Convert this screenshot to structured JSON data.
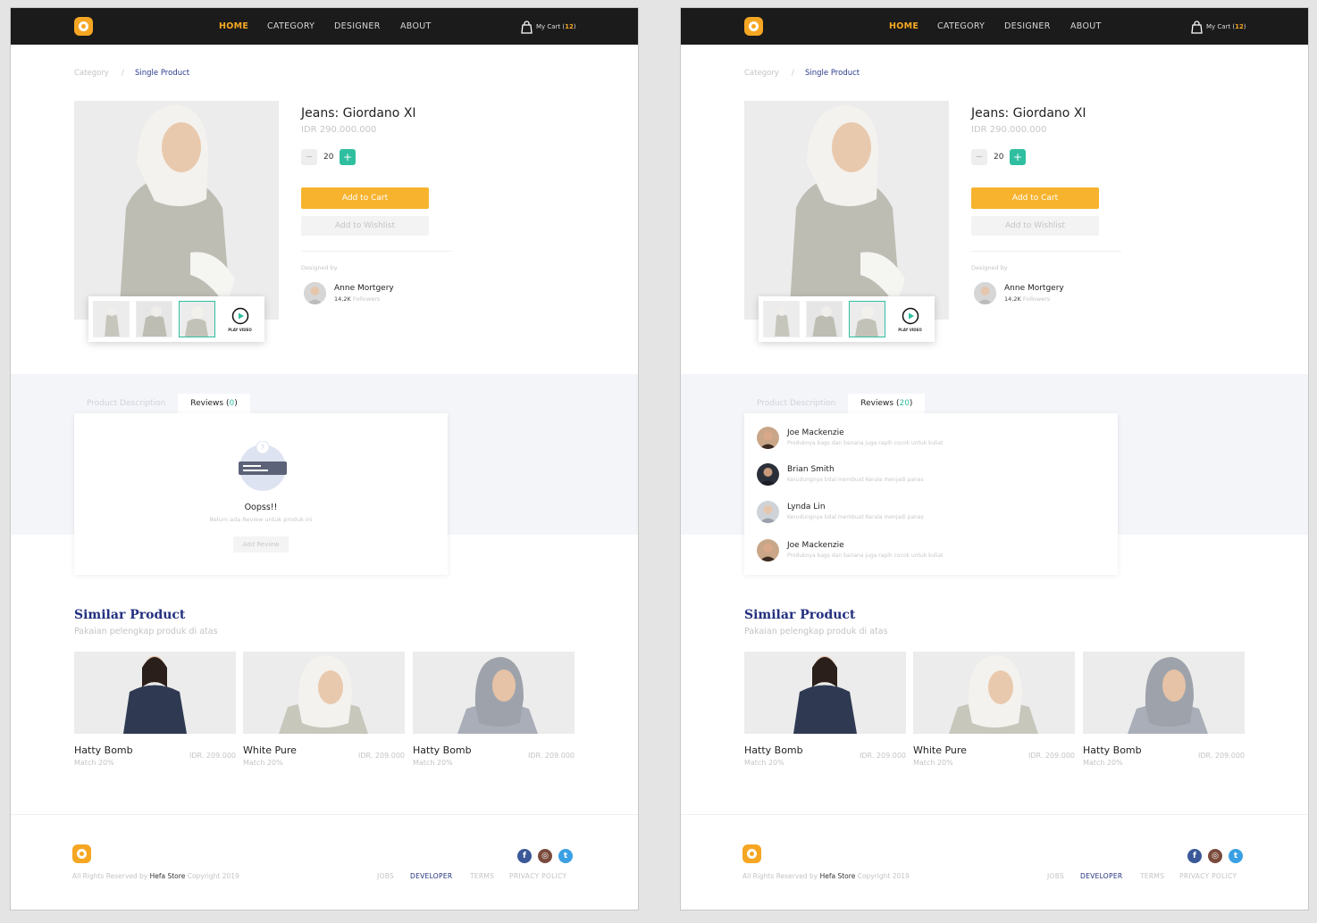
{
  "colors": {
    "accent": "#f7a823",
    "teal": "#2fbfa0",
    "navy": "#23307f",
    "nav_bg": "#1b1b1b",
    "grey_band": "#f4f5f9"
  },
  "nav": {
    "logo_icon": "logo-ring-icon",
    "items": [
      "HOME",
      "CATEGORY",
      "DESIGNER",
      "ABOUT"
    ],
    "active": "HOME",
    "cart_label": "My Cart (",
    "cart_count": "12",
    "cart_close": ")",
    "cart_icon": "shopping-bag-icon"
  },
  "breadcrumb": {
    "parent": "Category",
    "separator": "/",
    "current": "Single Product"
  },
  "product": {
    "title": "Jeans: Giordano XI",
    "price": "IDR 290.000.000",
    "quantity": "20",
    "minus": "−",
    "plus": "+",
    "add_to_cart": "Add to Cart",
    "add_to_wishlist": "Add to Wishlist",
    "play_video": "PLAY VIDEO",
    "designed_by": "Designed by",
    "designer_name": "Anne Mortgery",
    "designer_followers": "14,2K",
    "followers_label": "Followers"
  },
  "tabs_left": {
    "description": "Product Description",
    "reviews_label": "Reviews (",
    "reviews_count": "0",
    "reviews_close": ")"
  },
  "empty_reviews": {
    "title": "Oopss!!",
    "subtitle": "Belum ada Review untuk produk ini",
    "button": "Add Review"
  },
  "tabs_right": {
    "description": "Product Description",
    "reviews_label": "Reviews (",
    "reviews_count": "20",
    "reviews_close": ")"
  },
  "reviews": [
    {
      "name": "Joe Mackenzie",
      "text": "Produknya bags dan banana juga rapih cocok untuk kuliat"
    },
    {
      "name": "Brian Smith",
      "text": "Kerudungnya tidal membuat Kerala menjadi panas"
    },
    {
      "name": "Lynda Lin",
      "text": "Kerudungnya tidal membuat Kerala menjadi panas"
    },
    {
      "name": "Joe Mackenzie",
      "text": "Produknya bags dan banana juga rapih cocok untuk kuliat"
    }
  ],
  "similar": {
    "title": "Similar Product",
    "subtitle": "Pakaian pelengkap produk di atas",
    "items": [
      {
        "name": "Hatty Bomb",
        "match": "Match 20%",
        "price": "IDR. 209.000"
      },
      {
        "name": "White Pure",
        "match": "Match 20%",
        "price": "IDR. 209.000"
      },
      {
        "name": "Hatty Bomb",
        "match": "Match 20%",
        "price": "IDR. 209.000"
      }
    ]
  },
  "footer": {
    "copy_prefix": "All Rights Reserved by",
    "brand": "Hefa Store",
    "copy_suffix": "Copyright 2019",
    "links": [
      "JOBS",
      "DEVELOPER",
      "TERMS",
      "PRIVACY POLICY"
    ],
    "social": [
      "f",
      "◎",
      "t"
    ]
  }
}
